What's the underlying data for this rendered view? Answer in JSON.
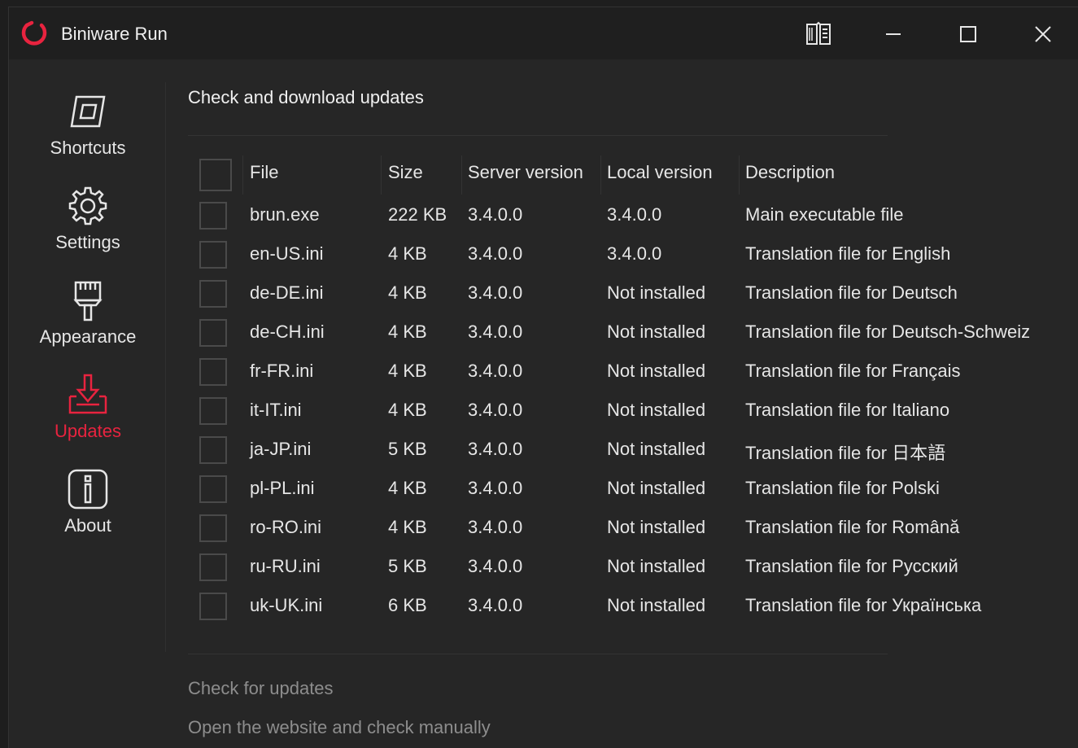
{
  "window": {
    "title": "Biniware Run",
    "accent_color": "#e8233f",
    "icons": {
      "app": "biniware-logo-icon",
      "docs": "book-icon",
      "minimize": "minimize-icon",
      "maximize": "maximize-icon",
      "close": "close-icon"
    }
  },
  "sidebar": {
    "items": [
      {
        "label": "Shortcuts",
        "icon": "shortcuts-icon",
        "active": false
      },
      {
        "label": "Settings",
        "icon": "gear-icon",
        "active": false
      },
      {
        "label": "Appearance",
        "icon": "brush-icon",
        "active": false
      },
      {
        "label": "Updates",
        "icon": "download-icon",
        "active": true
      },
      {
        "label": "About",
        "icon": "info-icon",
        "active": false
      }
    ]
  },
  "main": {
    "heading": "Check and download updates",
    "table": {
      "columns": [
        "File",
        "Size",
        "Server version",
        "Local version",
        "Description"
      ],
      "rows": [
        {
          "file": "brun.exe",
          "size": "222 KB",
          "server": "3.4.0.0",
          "local": "3.4.0.0",
          "desc": "Main executable file",
          "checked": false
        },
        {
          "file": "en-US.ini",
          "size": "4 KB",
          "server": "3.4.0.0",
          "local": "3.4.0.0",
          "desc": "Translation file for English",
          "checked": false
        },
        {
          "file": "de-DE.ini",
          "size": "4 KB",
          "server": "3.4.0.0",
          "local": "Not installed",
          "desc": "Translation file for Deutsch",
          "checked": false
        },
        {
          "file": "de-CH.ini",
          "size": "4 KB",
          "server": "3.4.0.0",
          "local": "Not installed",
          "desc": "Translation file for Deutsch-Schweiz",
          "checked": false
        },
        {
          "file": "fr-FR.ini",
          "size": "4 KB",
          "server": "3.4.0.0",
          "local": "Not installed",
          "desc": "Translation file for Français",
          "checked": false
        },
        {
          "file": "it-IT.ini",
          "size": "4 KB",
          "server": "3.4.0.0",
          "local": "Not installed",
          "desc": "Translation file for Italiano",
          "checked": false
        },
        {
          "file": "ja-JP.ini",
          "size": "5 KB",
          "server": "3.4.0.0",
          "local": "Not installed",
          "desc": "Translation file for 日本語",
          "checked": false
        },
        {
          "file": "pl-PL.ini",
          "size": "4 KB",
          "server": "3.4.0.0",
          "local": "Not installed",
          "desc": "Translation file for Polski",
          "checked": false
        },
        {
          "file": "ro-RO.ini",
          "size": "4 KB",
          "server": "3.4.0.0",
          "local": "Not installed",
          "desc": "Translation file for Română",
          "checked": false
        },
        {
          "file": "ru-RU.ini",
          "size": "5 KB",
          "server": "3.4.0.0",
          "local": "Not installed",
          "desc": "Translation file for Русский",
          "checked": false
        },
        {
          "file": "uk-UK.ini",
          "size": "6 KB",
          "server": "3.4.0.0",
          "local": "Not installed",
          "desc": "Translation file for Українська",
          "checked": false
        }
      ]
    },
    "links": {
      "check": "Check for updates",
      "open": "Open the website and check manually"
    }
  }
}
